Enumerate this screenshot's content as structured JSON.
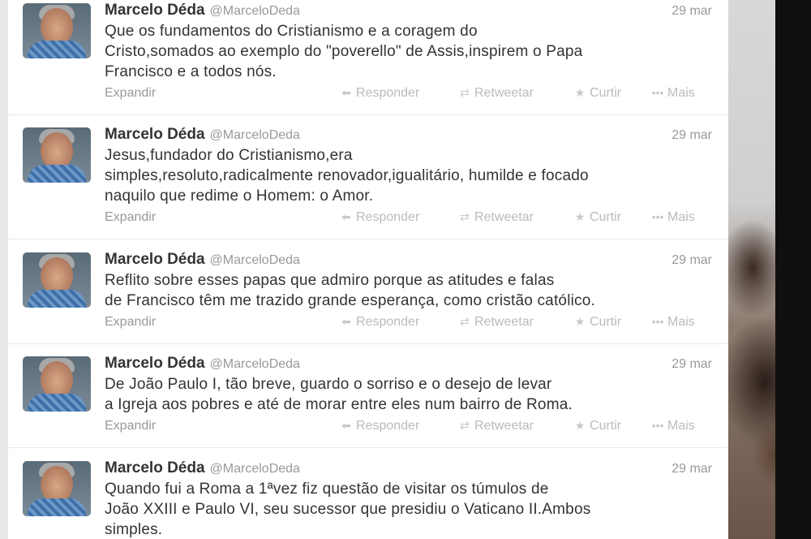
{
  "tweets": [
    {
      "name": "Marcelo Déda",
      "handle": "@MarceloDeda",
      "date": "29 mar",
      "lines": [
        "Que os fundamentos do Cristianismo e a coragem do",
        "Cristo,somados ao exemplo do \"poverello\" de Assis,inspirem o Papa",
        "Francisco e a todos nós."
      ]
    },
    {
      "name": "Marcelo Déda",
      "handle": "@MarceloDeda",
      "date": "29 mar",
      "lines": [
        "Jesus,fundador do Cristianismo,era",
        "simples,resoluto,radicalmente renovador,igualitário, humilde e focado",
        "naquilo que redime o Homem: o Amor."
      ]
    },
    {
      "name": "Marcelo Déda",
      "handle": "@MarceloDeda",
      "date": "29 mar",
      "lines": [
        "Reflito sobre esses papas que admiro porque as atitudes e falas",
        "de Francisco têm me trazido grande esperança, como cristão católico."
      ]
    },
    {
      "name": "Marcelo Déda",
      "handle": "@MarceloDeda",
      "date": "29 mar",
      "lines": [
        "De João Paulo I, tão breve, guardo o sorriso e o desejo de levar",
        "a Igreja aos pobres e até de morar entre eles num bairro de Roma."
      ]
    },
    {
      "name": "Marcelo Déda",
      "handle": "@MarceloDeda",
      "date": "29 mar",
      "lines": [
        "Quando fui a Roma a 1ªvez fiz questão de visitar os túmulos de",
        "João XXIII e Paulo VI, seu sucessor que presidiu o Vaticano II.Ambos",
        "simples."
      ]
    }
  ],
  "actions": {
    "expand": "Expandir",
    "reply": "Responder",
    "retweet": "Retweetar",
    "favorite": "Curtir",
    "more": "Mais",
    "reply_icon": "reply-arrow-icon",
    "retweet_icon": "retweet-icon",
    "favorite_icon": "star-icon",
    "more_icon": "ellipsis-icon"
  },
  "colors": {
    "name": "#333333",
    "meta": "#999999",
    "action": "#bbbbbb"
  }
}
